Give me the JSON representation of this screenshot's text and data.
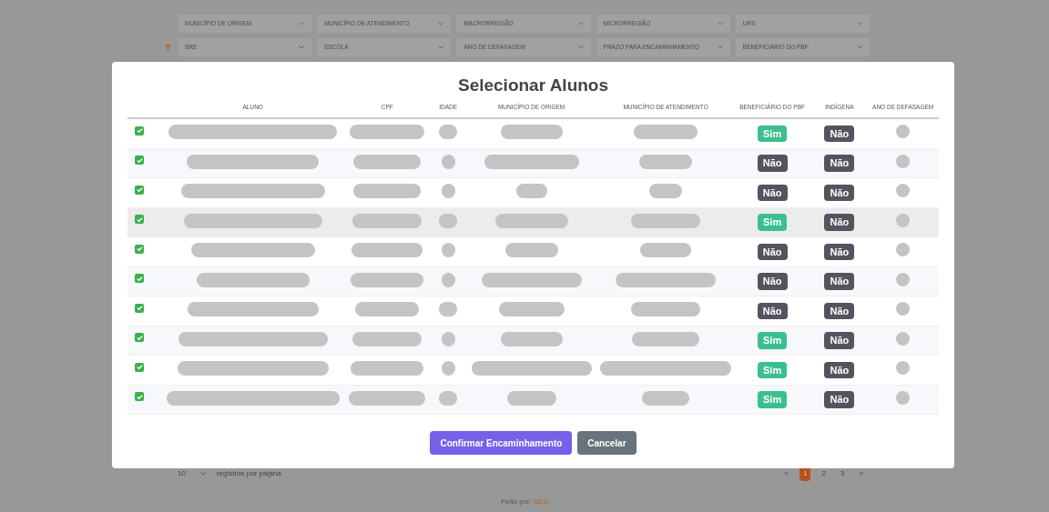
{
  "filters": [
    {
      "label": "MUNICÍPIO DE ORIGEM"
    },
    {
      "label": "MUNICÍPIO DE ATENDIMENTO"
    },
    {
      "label": "MACRORREGIÃO"
    },
    {
      "label": "MICRORREGIÃO"
    },
    {
      "label": "URS"
    },
    {
      "label": "SRE"
    },
    {
      "label": "ESCOLA"
    },
    {
      "label": "ANO DE DEFASAGEM"
    },
    {
      "label": "PRAZO PARA ENCAMINHAMENTO"
    },
    {
      "label": "BENEFICIÁRIO DO PBF"
    }
  ],
  "page_size": "10",
  "page_size_label": "registros por página",
  "pagination": [
    {
      "label": "<",
      "selected": false
    },
    {
      "label": "1",
      "selected": true
    },
    {
      "label": "2",
      "selected": false
    },
    {
      "label": "3",
      "selected": false
    },
    {
      "label": ">",
      "selected": false
    }
  ],
  "footer": {
    "text": "Feito por",
    "link": "SES"
  },
  "modal": {
    "title": "Selecionar Alunos",
    "columns": [
      "ALUNO",
      "CPF",
      "IDADE",
      "MUNICÍPIO DE ORIGEM",
      "MUNICÍPIO DE ATENDIMENTO",
      "BENEFICIÁRIO DO PBF",
      "INDÍGENA",
      "ANO DE DEFASAGEM"
    ],
    "rows": [
      {
        "checked": true,
        "hovered": false,
        "pbf": {
          "text": "Sim",
          "positive": true
        },
        "indigena": {
          "text": "Não",
          "positive": false
        }
      },
      {
        "checked": true,
        "hovered": false,
        "pbf": {
          "text": "Não",
          "positive": false
        },
        "indigena": {
          "text": "Não",
          "positive": false
        }
      },
      {
        "checked": true,
        "hovered": false,
        "pbf": {
          "text": "Não",
          "positive": false
        },
        "indigena": {
          "text": "Não",
          "positive": false
        }
      },
      {
        "checked": true,
        "hovered": true,
        "pbf": {
          "text": "Sim",
          "positive": true
        },
        "indigena": {
          "text": "Não",
          "positive": false
        }
      },
      {
        "checked": true,
        "hovered": false,
        "pbf": {
          "text": "Não",
          "positive": false
        },
        "indigena": {
          "text": "Não",
          "positive": false
        }
      },
      {
        "checked": true,
        "hovered": false,
        "pbf": {
          "text": "Não",
          "positive": false
        },
        "indigena": {
          "text": "Não",
          "positive": false
        }
      },
      {
        "checked": true,
        "hovered": false,
        "pbf": {
          "text": "Não",
          "positive": false
        },
        "indigena": {
          "text": "Não",
          "positive": false
        }
      },
      {
        "checked": true,
        "hovered": false,
        "pbf": {
          "text": "Sim",
          "positive": true
        },
        "indigena": {
          "text": "Não",
          "positive": false
        }
      },
      {
        "checked": true,
        "hovered": false,
        "pbf": {
          "text": "Sim",
          "positive": true
        },
        "indigena": {
          "text": "Não",
          "positive": false
        }
      },
      {
        "checked": true,
        "hovered": false,
        "pbf": {
          "text": "Sim",
          "positive": true
        },
        "indigena": {
          "text": "Não",
          "positive": false
        }
      }
    ],
    "buttons": [
      {
        "label": "Confirmar Encaminhamento",
        "kind": "primary"
      },
      {
        "label": "Cancelar",
        "kind": "secondary"
      }
    ]
  }
}
